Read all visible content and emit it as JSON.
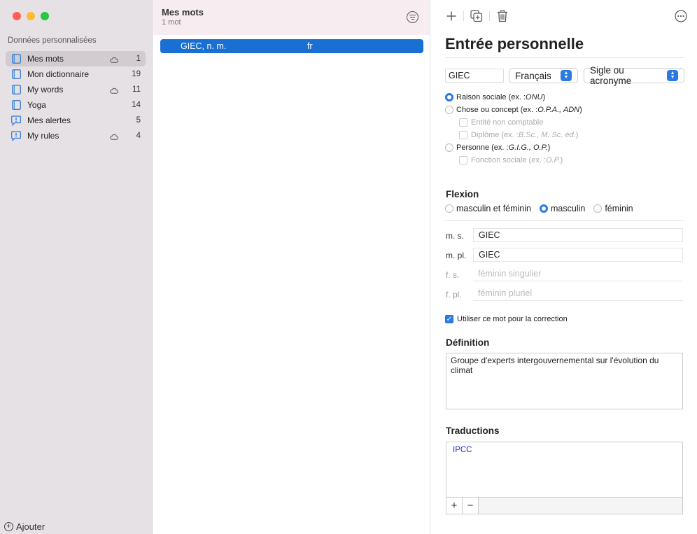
{
  "window": {
    "traffic_lights": {
      "close": "#ff5f57",
      "minimize": "#febc2e",
      "zoom": "#28c840"
    }
  },
  "sidebar": {
    "header": "Données personnalisées",
    "items": [
      {
        "label": "Mes mots",
        "count": "1",
        "icon": "book-icon",
        "synced": true,
        "selected": true
      },
      {
        "label": "Mon dictionnaire",
        "count": "19",
        "icon": "book-icon",
        "synced": false,
        "selected": false
      },
      {
        "label": "My words",
        "count": "11",
        "icon": "book-icon",
        "synced": true,
        "selected": false
      },
      {
        "label": "Yoga",
        "count": "14",
        "icon": "book-icon",
        "synced": false,
        "selected": false
      },
      {
        "label": "Mes alertes",
        "count": "5",
        "icon": "alert-bubble-icon",
        "synced": false,
        "selected": false
      },
      {
        "label": "My rules",
        "count": "4",
        "icon": "alert-bubble-icon",
        "synced": true,
        "selected": false
      }
    ],
    "add_label": "Ajouter"
  },
  "list": {
    "title": "Mes mots",
    "subtitle": "1 mot",
    "rows": [
      {
        "word": "GIEC, n. m.",
        "lang": "fr",
        "selected": true
      }
    ]
  },
  "detail": {
    "title": "Entrée personnelle",
    "word": "GIEC",
    "language": "Français",
    "category": "Sigle ou acronyme",
    "type_options": {
      "raison_sociale": {
        "label": "Raison sociale (ex. : ",
        "example": "ONU",
        "suffix": ")",
        "selected": true
      },
      "chose": {
        "label": "Chose ou concept (ex. : ",
        "example": "O.P.A., ADN",
        "suffix": ")",
        "selected": false
      },
      "entite": {
        "label": "Entité non comptable"
      },
      "diplome": {
        "label": "Diplôme (ex. : ",
        "example": "B.Sc., M. Sc. éd.",
        "suffix": ")"
      },
      "personne": {
        "label": "Personne (ex. : ",
        "example": "G.I.G., O.P.",
        "suffix": ")",
        "selected": false
      },
      "fonction": {
        "label": "Fonction sociale (ex. : ",
        "example": "O.P.",
        "suffix": ")"
      }
    },
    "flexion": {
      "heading": "Flexion",
      "options": [
        "masculin et féminin",
        "masculin",
        "féminin"
      ],
      "selected": "masculin"
    },
    "inflections": [
      {
        "label": "m. s.",
        "value": "GIEC",
        "placeholder": ""
      },
      {
        "label": "m. pl.",
        "value": "GIEC",
        "placeholder": ""
      },
      {
        "label": "f. s.",
        "value": "",
        "placeholder": "féminin singulier"
      },
      {
        "label": "f. pl.",
        "value": "",
        "placeholder": "féminin pluriel"
      }
    ],
    "use_for_correction": {
      "label": "Utiliser ce mot pour la correction",
      "checked": true
    },
    "definition": {
      "heading": "Définition",
      "text": "Groupe d'experts intergouvernemental sur l'évolution du climat"
    },
    "translations": {
      "heading": "Traductions",
      "items": [
        "IPCC"
      ],
      "add_label": "+",
      "remove_label": "−"
    }
  },
  "colors": {
    "accent": "#2b7ae0",
    "selection": "#1a6fd3",
    "sidebar_bg": "#e6e1e4",
    "list_header_bg": "#f7ecef"
  }
}
